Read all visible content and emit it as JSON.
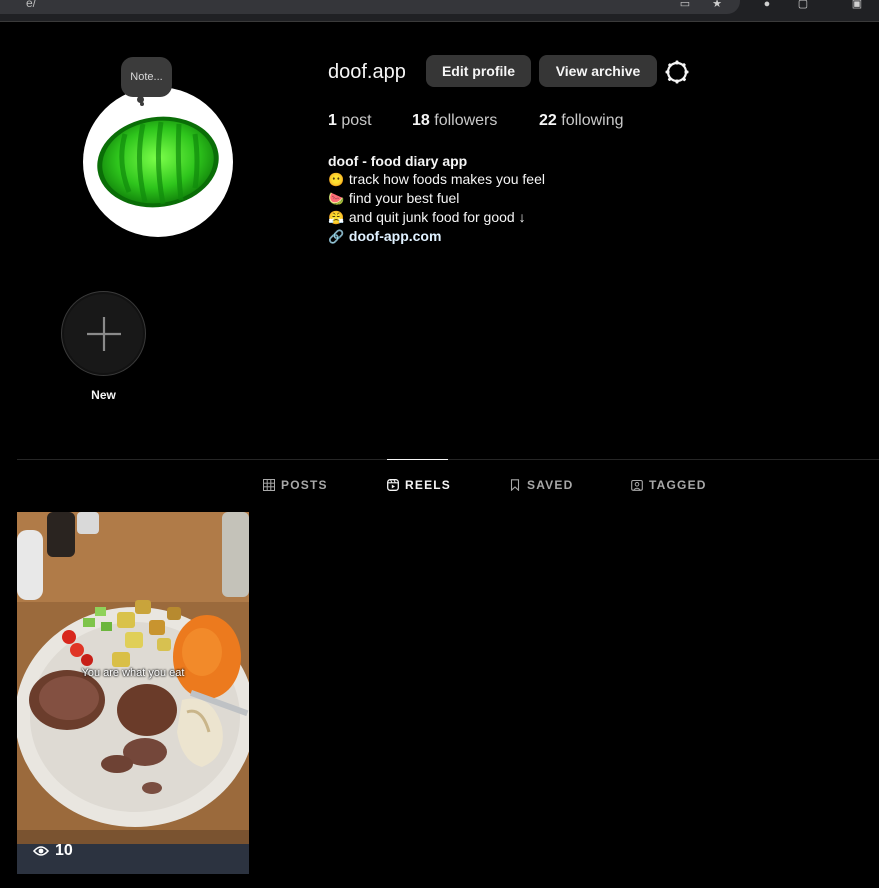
{
  "browser": {
    "url_fragment": "e/"
  },
  "profile": {
    "username": "doof.app",
    "note": "Note...",
    "edit_profile": "Edit profile",
    "view_archive": "View archive"
  },
  "stats": {
    "posts_count": "1",
    "posts_label": "post",
    "followers_count": "18",
    "followers_label": "followers",
    "following_count": "22",
    "following_label": "following"
  },
  "bio": {
    "name": "doof - food diary app",
    "line1": "track how foods makes you feel",
    "line2": "find your best fuel",
    "line3": "and quit junk food for good ↓",
    "link": "doof-app.com"
  },
  "highlights": {
    "new_label": "New"
  },
  "tabs": [
    {
      "label": "POSTS",
      "icon": "grid-icon"
    },
    {
      "label": "REELS",
      "icon": "reels-icon",
      "active": true
    },
    {
      "label": "SAVED",
      "icon": "bookmark-icon"
    },
    {
      "label": "TAGGED",
      "icon": "tag-user-icon"
    }
  ],
  "reel": {
    "caption": "You are what you eat",
    "views": "10"
  },
  "colors": {
    "background": "#000000",
    "button": "#363636",
    "avatar_green": "#2ec51c"
  }
}
